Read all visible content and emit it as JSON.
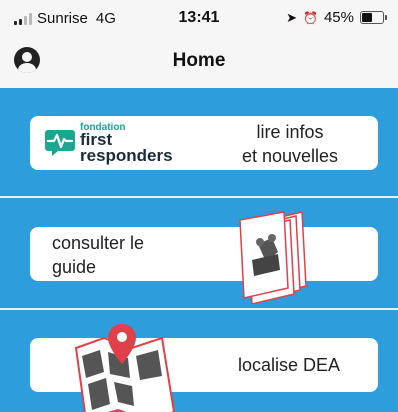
{
  "status_bar": {
    "carrier": "Sunrise",
    "network": "4G",
    "time": "13:41",
    "battery": "45%",
    "battery_level": 0.45
  },
  "nav": {
    "title": "Home"
  },
  "cards": {
    "news": {
      "logo_small": "fondation",
      "logo_line1": "first",
      "logo_line2": "responders",
      "label_line1": "lire infos",
      "label_line2": "et nouvelles"
    },
    "guide": {
      "label_line1": "consulter le",
      "label_line2": "guide"
    },
    "aed": {
      "label": "localise DEA"
    }
  },
  "colors": {
    "accent": "#2e9ddc",
    "logo_green": "#1aa68f",
    "map_red": "#e0404a"
  }
}
